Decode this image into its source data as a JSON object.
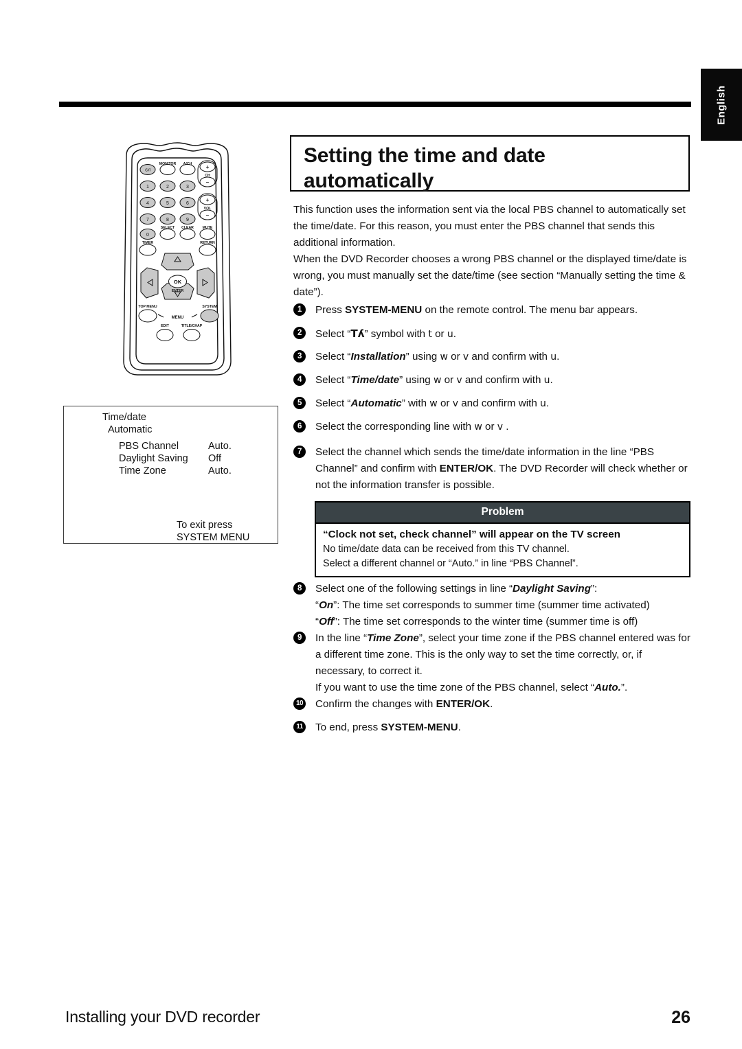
{
  "language_tab": {
    "label": "English"
  },
  "title": {
    "line1": "Setting the time and date",
    "line2": "automatically"
  },
  "intro": {
    "paragraph1": "This function uses the information sent via the local PBS channel to automatically set the time/date. For this reason, you must enter the PBS channel that sends this additional information.",
    "paragraph2": "When the DVD Recorder chooses a wrong PBS channel or the displayed time/date is wrong, you must manually set the date/time (see section “Manually setting the time & date”)."
  },
  "steps": [
    {
      "num": "1",
      "text_pre": "Press ",
      "bold1": "SYSTEM-MENU",
      "text_post": " on the remote control. The menu bar appears."
    },
    {
      "num": "2",
      "text_pre": "Select “",
      "symbol": "Τʎ",
      "text_mid": "” symbol with ",
      "arrow1": "t",
      "text_mid2": " or ",
      "arrow2": "u",
      "text_post": "."
    },
    {
      "num": "3",
      "text_pre": "Select “",
      "italic": "Installation",
      "text_mid": "” using ",
      "arrow1": "w",
      "text_mid2": " or ",
      "arrow2": "v",
      "text_mid3": " and confirm with ",
      "arrow3": "u",
      "text_post": "."
    },
    {
      "num": "4",
      "text_pre": "Select “",
      "italic": "Time/date",
      "text_mid": "” using ",
      "arrow1": "w",
      "text_mid2": " or ",
      "arrow2": "v",
      "text_mid3": " and confirm with ",
      "arrow3": "u",
      "text_post": "."
    },
    {
      "num": "5",
      "text_pre": "Select “",
      "italic": "Automatic",
      "text_mid": "” with ",
      "arrow1": "w",
      "text_mid2": " or ",
      "arrow2": "v",
      "text_mid3": " and confirm with ",
      "arrow3": "u",
      "text_post": "."
    },
    {
      "num": "6",
      "text_pre": "Select the corresponding line with ",
      "arrow1": "w",
      "text_mid2": " or ",
      "arrow2": "v",
      "text_post": " ."
    },
    {
      "num": "7",
      "text_pre": "Select the channel which sends the time/date information in the line “PBS Channel” and confirm with ",
      "bold1": "ENTER/OK",
      "text_post": ". The DVD Recorder will check whether or not the information transfer is possible."
    },
    {
      "num": "8",
      "text_pre": "Select one of the following settings in line “",
      "italic": "Daylight Saving",
      "text_post": "”:",
      "sub_on_q": "“",
      "sub_on_i": "On",
      "sub_on_rest": "”: The time set corresponds to summer time (summer time activated)",
      "sub_off_q": "“",
      "sub_off_i": "Off",
      "sub_off_rest": "”: The time set corresponds to the winter time (summer time is off)"
    },
    {
      "num": "9",
      "text_pre": "In the line “",
      "italic": "Time Zone",
      "text_post": "”, select your time zone if the PBS channel entered was for a different time zone. This is the only way to set the time correctly, or, if necessary, to correct it.",
      "sub2_pre": "If you want to use the time zone of the PBS channel, select “",
      "sub2_i": "Auto.",
      "sub2_post": "”."
    },
    {
      "num": "10",
      "text_pre": "Confirm the changes with ",
      "bold1": "ENTER/OK",
      "text_post": "."
    },
    {
      "num": "11",
      "text_pre": "To end, press ",
      "bold1": "SYSTEM-MENU",
      "text_post": "."
    }
  ],
  "problem": {
    "header": "Problem",
    "title": "“Clock not set, check channel” will appear on the TV screen",
    "line1": "No time/date data can be received from this TV channel.",
    "line2": "Select a different channel or “Auto.” in line “PBS Channel”.",
    "header_bg": "#3a4347"
  },
  "osd_screen": {
    "title": "Time/date",
    "subtitle": "Automatic",
    "rows": [
      {
        "key": "PBS Channel",
        "value": "Auto."
      },
      {
        "key": "Daylight Saving",
        "value": "Off"
      },
      {
        "key": "Time Zone",
        "value": "Auto."
      }
    ],
    "exit_line1": "To exit press",
    "exit_line2": "SYSTEM MENU"
  },
  "remote": {
    "labels": {
      "monitor": "MONITOR",
      "a_ch": "A/CH",
      "ch": "CH",
      "vol": "VOL",
      "select": "SELECT",
      "clear": "CLEAR",
      "mute": "MUTE",
      "timer": "TIMER",
      "return": "RETURN",
      "top_menu": "TOP MENU",
      "system": "SYSTEM",
      "menu": "MENU",
      "edit": "EDIT",
      "title_chap": "TITLE/CHAP",
      "ok": "OK",
      "enter": "ENTER",
      "power": "⏻/I",
      "plus": "+",
      "minus": "–"
    },
    "numbers": [
      "1",
      "2",
      "3",
      "4",
      "5",
      "6",
      "7",
      "8",
      "9",
      "0"
    ]
  },
  "footer": {
    "section_title": "Installing your DVD recorder",
    "page_number": "26"
  }
}
